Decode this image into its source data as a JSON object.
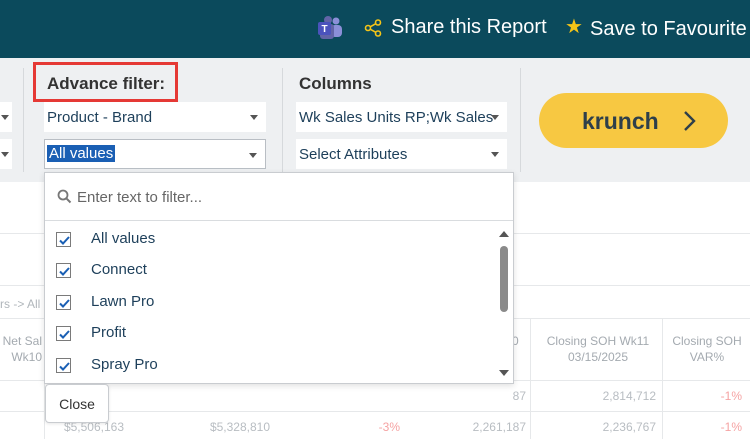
{
  "topbar": {
    "teams_icon": "microsoft-teams-icon",
    "share_label": "Share this Report",
    "favourite_label": "Save to Favourite",
    "star_icon": "★"
  },
  "filters": {
    "advance_title": "Advance filter:",
    "columns_title": "Columns",
    "dimension_value": "Product - Brand",
    "values_selected": "All values",
    "columns_value": "Wk Sales Units RP;Wk Sales",
    "attributes_value": "Select Attributes",
    "krunch_label": "krunch"
  },
  "dropdown": {
    "search_placeholder": "Enter text to filter...",
    "items": [
      {
        "label": "All values",
        "checked": true
      },
      {
        "label": "Connect",
        "checked": true
      },
      {
        "label": "Lawn Pro",
        "checked": true
      },
      {
        "label": "Profit",
        "checked": true
      },
      {
        "label": "Spray Pro",
        "checked": true
      }
    ],
    "close_label": "Close"
  },
  "background": {
    "breadcrumb": "rs -> All",
    "headers": {
      "net_sales": "Net Sal\nWk10",
      "col0": "0",
      "closing_soh": "Closing SOH Wk11\n03/15/2025",
      "closing_var": "Closing SOH\nVAR%"
    },
    "rows": [
      {
        "c1": "87",
        "c2": "2,814,712",
        "c3": "-1%"
      },
      {
        "c0a": "$5,506,163",
        "c0b": "$5,328,810",
        "c0c": "-3%",
        "c1": "2,261,187",
        "c2": "2,236,767",
        "c3": "-1%"
      }
    ]
  },
  "colors": {
    "topbar": "#0b4a5c",
    "highlight_border": "#e53935",
    "krunch_button": "#f7c842",
    "selected_text_bg": "#1a5fb4",
    "negative": "#f5a3a3"
  }
}
